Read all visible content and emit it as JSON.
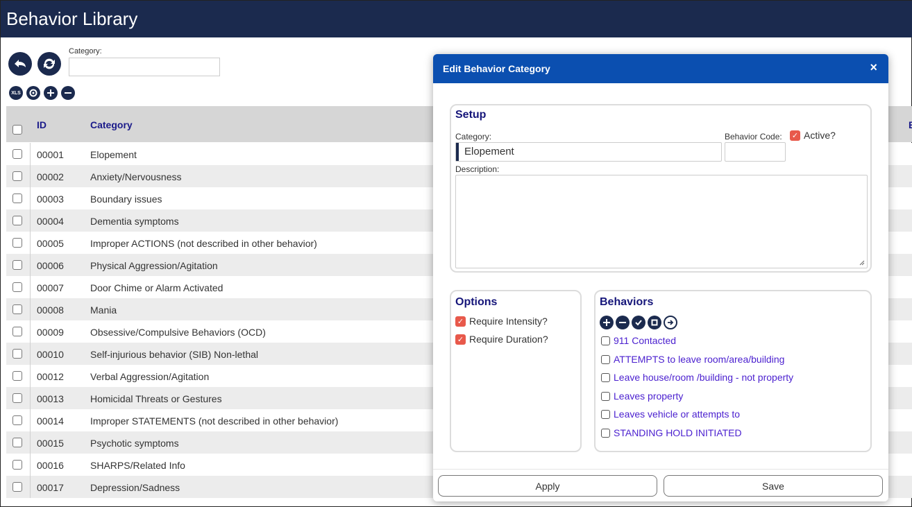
{
  "app": {
    "title": "Behavior Library"
  },
  "toolbar": {
    "category_label": "Category:",
    "category_value": "",
    "xls_label": "XLS"
  },
  "grid": {
    "columns": {
      "id": "ID",
      "category": "Category",
      "right_edge": "B"
    },
    "rows": [
      {
        "id": "00001",
        "category": "Elopement"
      },
      {
        "id": "00002",
        "category": "Anxiety/Nervousness"
      },
      {
        "id": "00003",
        "category": "Boundary issues"
      },
      {
        "id": "00004",
        "category": "Dementia symptoms"
      },
      {
        "id": "00005",
        "category": "Improper ACTIONS (not described in other behavior)"
      },
      {
        "id": "00006",
        "category": "Physical Aggression/Agitation"
      },
      {
        "id": "00007",
        "category": "Door Chime or Alarm Activated"
      },
      {
        "id": "00008",
        "category": "Mania"
      },
      {
        "id": "00009",
        "category": "Obsessive/Compulsive Behaviors (OCD)"
      },
      {
        "id": "00010",
        "category": "Self-injurious behavior (SIB) Non-lethal"
      },
      {
        "id": "00012",
        "category": "Verbal Aggression/Agitation"
      },
      {
        "id": "00013",
        "category": "Homicidal Threats or Gestures"
      },
      {
        "id": "00014",
        "category": "Improper STATEMENTS (not described in other behavior)"
      },
      {
        "id": "00015",
        "category": "Psychotic symptoms"
      },
      {
        "id": "00016",
        "category": "SHARPS/Related Info"
      },
      {
        "id": "00017",
        "category": "Depression/Sadness"
      }
    ]
  },
  "dialog": {
    "title": "Edit Behavior Category",
    "close": "×",
    "setup": {
      "legend": "Setup",
      "category_label": "Category:",
      "category_value": "Elopement",
      "behavior_code_label": "Behavior Code:",
      "behavior_code_value": "",
      "active_label": "Active?",
      "description_label": "Description:",
      "description_value": ""
    },
    "options": {
      "legend": "Options",
      "require_intensity": "Require Intensity?",
      "require_duration": "Require Duration?"
    },
    "behaviors": {
      "legend": "Behaviors",
      "icons": [
        "plus-icon",
        "minus-icon",
        "check-icon",
        "stop-icon",
        "arrow-right-icon"
      ],
      "items": [
        "911 Contacted",
        "ATTEMPTS to leave room/area/building",
        "Leave house/room /building - not property",
        "Leaves property",
        "Leaves vehicle or attempts to",
        "STANDING HOLD INITIATED"
      ]
    },
    "buttons": {
      "apply": "Apply",
      "save": "Save"
    }
  },
  "colors": {
    "header": "#1b2a4e",
    "dialog_title": "#0b4fb0",
    "accent_check": "#e8594b",
    "link": "#4a1fcf"
  }
}
